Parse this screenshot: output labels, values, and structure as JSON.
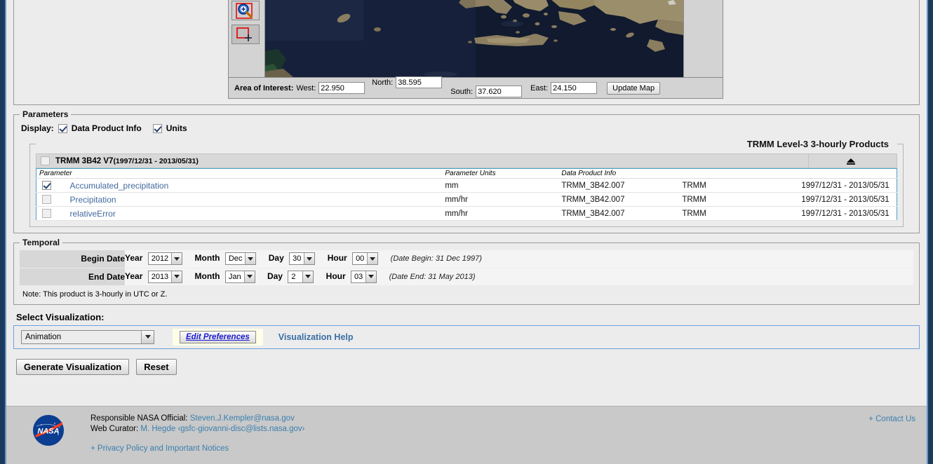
{
  "map": {
    "tools": [
      {
        "name": "zoom-in-tool",
        "active": true
      },
      {
        "name": "box-select-tool",
        "active": false
      }
    ],
    "aoi": {
      "label": "Area of Interest:",
      "west_label": "West:",
      "west_value": "22.950",
      "north_label": "North:",
      "north_value": "38.595",
      "south_label": "South:",
      "south_value": "37.620",
      "east_label": "East:",
      "east_value": "24.150",
      "update_button": "Update Map"
    }
  },
  "parameters": {
    "legend": "Parameters",
    "display_label": "Display:",
    "display_options": [
      {
        "label": "Data Product Info",
        "checked": true
      },
      {
        "label": "Units",
        "checked": true
      }
    ],
    "group_legend": "TRMM Level-3 3-hourly Products",
    "product_header": {
      "checked": false,
      "title": "TRMM 3B42 V7",
      "range": "(1997/12/31 - 2013/05/31)",
      "collapse_icon": "collapse-triangle-icon"
    },
    "columns": [
      "Parameter",
      "Parameter Units",
      "Data Product Info",
      "",
      ""
    ],
    "rows": [
      {
        "checked": true,
        "name": "Accumulated_precipitation",
        "units": "mm",
        "product_id": "TRMM_3B42.007",
        "mission": "TRMM",
        "date_range": "1997/12/31 - 2013/05/31"
      },
      {
        "checked": false,
        "name": "Precipitation",
        "units": "mm/hr",
        "product_id": "TRMM_3B42.007",
        "mission": "TRMM",
        "date_range": "1997/12/31 - 2013/05/31"
      },
      {
        "checked": false,
        "name": "relativeError",
        "units": "mm/hr",
        "product_id": "TRMM_3B42.007",
        "mission": "TRMM",
        "date_range": "1997/12/31 - 2013/05/31"
      }
    ]
  },
  "temporal": {
    "legend": "Temporal",
    "year_label": "Year",
    "month_label": "Month",
    "day_label": "Day",
    "hour_label": "Hour",
    "begin": {
      "label": "Begin Date",
      "year": "2012",
      "month": "Dec",
      "day": "30",
      "hour": "00",
      "hint": "(Date Begin: 31 Dec 1997)"
    },
    "end": {
      "label": "End Date",
      "year": "2013",
      "month": "Jan",
      "day": "2",
      "hour": "03",
      "hint": "(Date End: 31 May 2013)"
    },
    "note": "Note: This product is 3-hourly in UTC or Z."
  },
  "visualization": {
    "title": "Select Visualization:",
    "selected": "Animation",
    "edit_preferences": "Edit Preferences",
    "help_link": "Visualization Help",
    "generate_button": "Generate Visualization",
    "reset_button": "Reset"
  },
  "footer": {
    "logo": "nasa-logo",
    "official_label": "Responsible NASA Official:",
    "official_email": "Steven.J.Kempler@nasa.gov",
    "curator_label": "Web Curator:",
    "curator_name": "M. Hegde",
    "curator_email": "‹gsfc-giovanni-disc@lists.nasa.gov›",
    "privacy_link": "+ Privacy Policy and Important Notices",
    "contact_link": "+ Contact Us"
  },
  "colors": {
    "link": "#3b7fae",
    "param_link": "#41699e",
    "accent_border": "#4aa3c7",
    "vis_border": "#6f9fd8",
    "page_rail": "#1c3a5e"
  }
}
